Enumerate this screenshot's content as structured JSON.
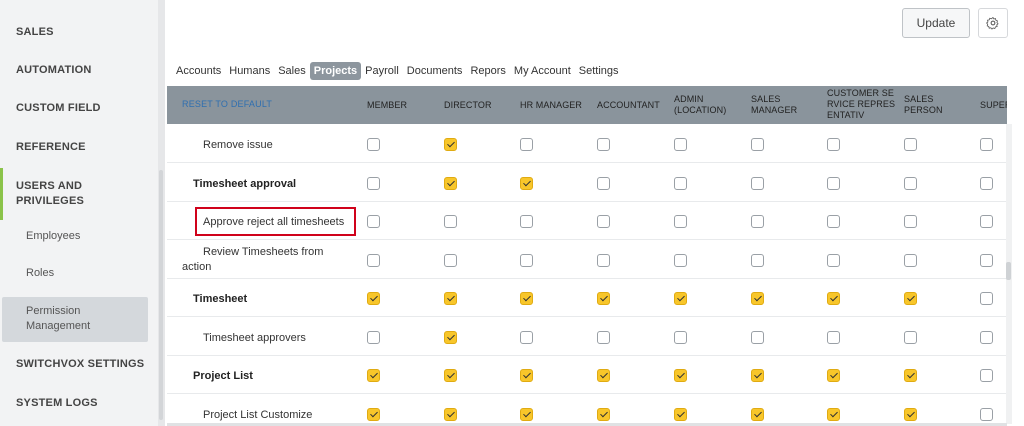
{
  "sidebar": {
    "items": [
      {
        "label": "SALES"
      },
      {
        "label": "AUTOMATION"
      },
      {
        "label": "CUSTOM FIELD"
      },
      {
        "label": "REFERENCE"
      },
      {
        "label": "USERS AND PRIVILEGES"
      },
      {
        "label": "SWITCHVOX SETTINGS"
      },
      {
        "label": "SYSTEM LOGS"
      }
    ],
    "subitems": [
      {
        "label": "Employees"
      },
      {
        "label": "Roles"
      },
      {
        "label": "Permission Management"
      }
    ],
    "active_accent_color": "#8bc34a"
  },
  "header": {
    "update_label": "Update",
    "settings_icon": "gear-icon"
  },
  "tabs": [
    {
      "label": "Accounts"
    },
    {
      "label": "Humans"
    },
    {
      "label": "Sales"
    },
    {
      "label": "Projects",
      "active": true
    },
    {
      "label": "Payroll"
    },
    {
      "label": "Documents"
    },
    {
      "label": "Repors"
    },
    {
      "label": "My Account"
    },
    {
      "label": "Settings"
    }
  ],
  "table": {
    "reset_label": "RESET TO DEFAULT",
    "columns": [
      {
        "label": "MEMBER"
      },
      {
        "label": "DIRECTOR"
      },
      {
        "label": "HR MANAGER"
      },
      {
        "label": "ACCOUNTANT"
      },
      {
        "label": "ADMIN (LOCATION)"
      },
      {
        "label": "SALES MANAGER"
      },
      {
        "label": "CUSTOMER SERVICE REPRESENTATIV"
      },
      {
        "label": "SALES PERSON"
      },
      {
        "label": "SUPER"
      }
    ],
    "rows": [
      {
        "label": "Remove issue",
        "bold": false,
        "checks": [
          false,
          true,
          false,
          false,
          false,
          false,
          false,
          false,
          false
        ]
      },
      {
        "label": "Timesheet approval",
        "bold": true,
        "checks": [
          false,
          true,
          true,
          false,
          false,
          false,
          false,
          false,
          false
        ]
      },
      {
        "label": "Approve reject all timesheets",
        "bold": false,
        "highlighted": true,
        "checks": [
          false,
          false,
          false,
          false,
          false,
          false,
          false,
          false,
          false
        ]
      },
      {
        "label": "Review Timesheets from action",
        "bold": false,
        "checks": [
          false,
          false,
          false,
          false,
          false,
          false,
          false,
          false,
          false
        ]
      },
      {
        "label": "Timesheet",
        "bold": true,
        "checks": [
          true,
          true,
          true,
          true,
          true,
          true,
          true,
          true,
          false
        ]
      },
      {
        "label": "Timesheet approvers",
        "bold": false,
        "checks": [
          false,
          true,
          false,
          false,
          false,
          false,
          false,
          false,
          false
        ]
      },
      {
        "label": "Project List",
        "bold": true,
        "checks": [
          true,
          true,
          true,
          true,
          true,
          true,
          true,
          true,
          false
        ]
      },
      {
        "label": "Project List Customize",
        "bold": false,
        "checks": [
          true,
          true,
          true,
          true,
          true,
          true,
          true,
          true,
          false
        ]
      }
    ],
    "checked_color": "#f8c62a",
    "header_color": "#8a949c",
    "highlight_color": "#d0021b"
  }
}
